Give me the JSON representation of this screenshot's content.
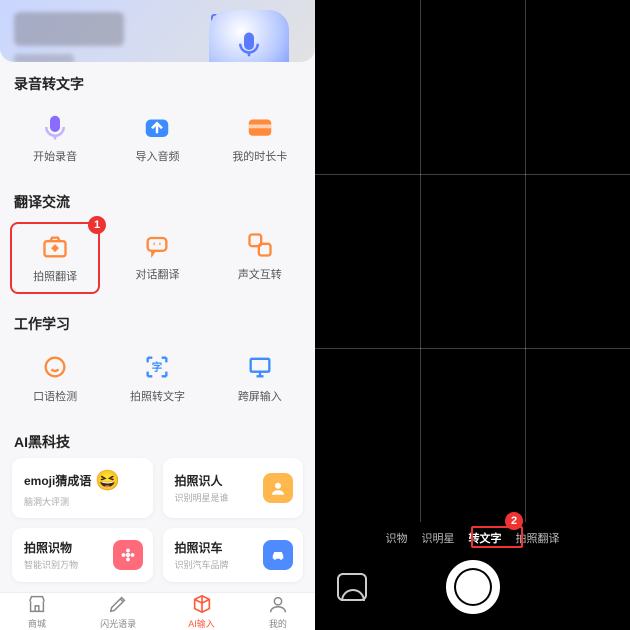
{
  "left": {
    "sections": {
      "audio": {
        "title": "录音转文字",
        "items": [
          "开始录音",
          "导入音频",
          "我的时长卡"
        ]
      },
      "translate": {
        "title": "翻译交流",
        "items": [
          "拍照翻译",
          "对话翻译",
          "声文互转"
        ]
      },
      "study": {
        "title": "工作学习",
        "items": [
          "口语检测",
          "拍照转文字",
          "跨屏输入"
        ]
      },
      "ai": {
        "title": "AI黑科技",
        "cards": [
          {
            "title": "emoji猜成语",
            "sub": "脑洞大评测"
          },
          {
            "title": "拍照识人",
            "sub": "识别明星是谁"
          },
          {
            "title": "拍照识物",
            "sub": "智能识别万物"
          },
          {
            "title": "拍照识车",
            "sub": "识别汽车品牌"
          }
        ]
      }
    },
    "tabs": [
      "商城",
      "闪光语录",
      "AI输入",
      "我的"
    ],
    "active_tab_index": 2,
    "highlight_index": 0,
    "badge1": "1"
  },
  "right": {
    "modes": [
      "识物",
      "识明星",
      "转文字",
      "拍照翻译"
    ],
    "active_mode_index": 2,
    "badge2": "2"
  },
  "colors": {
    "accent_purple": "#8a6cff",
    "accent_blue": "#3c8cff",
    "accent_orange": "#ff8a3c",
    "accent_red": "#e33",
    "tab_active": "#ff5a3c"
  }
}
